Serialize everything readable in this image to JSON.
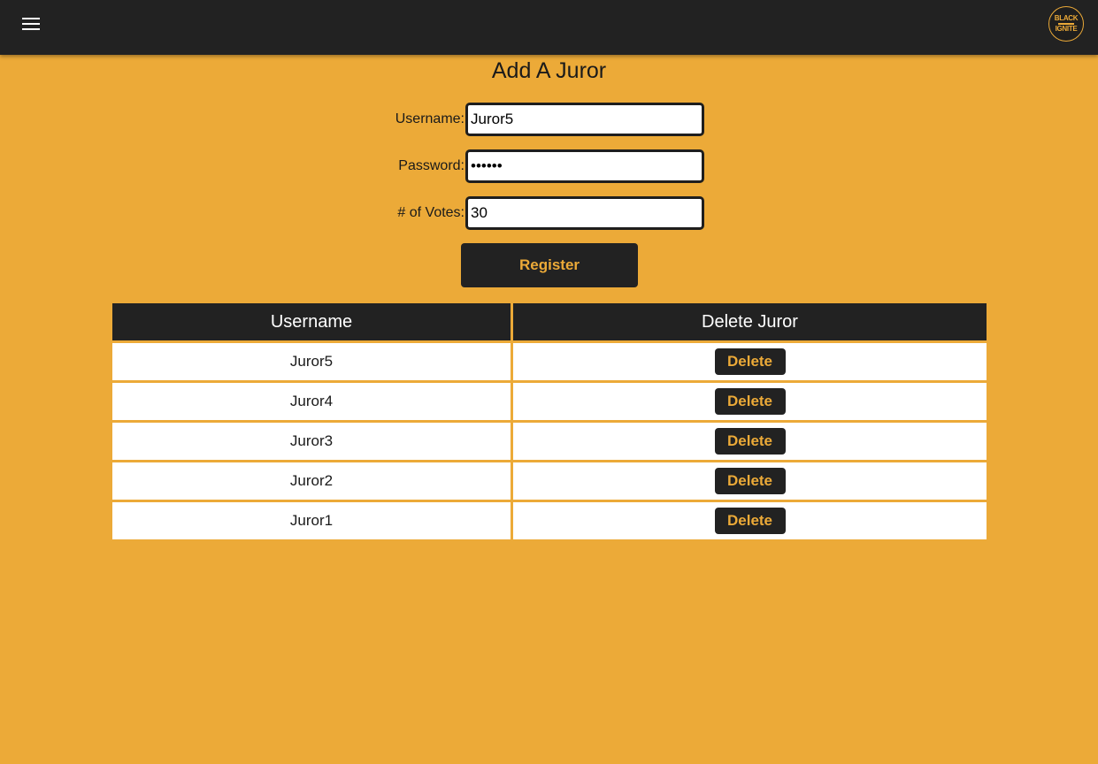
{
  "header": {
    "menu_icon": "hamburger-menu-icon",
    "logo_line1": "BLACK",
    "logo_line2": "IGNITE"
  },
  "form": {
    "title": "Add A Juror",
    "username_label": "Username:",
    "username_value": "Juror5",
    "password_label": "Password:",
    "password_value": "••••••",
    "votes_label": "# of Votes:",
    "votes_value": "30",
    "register_label": "Register"
  },
  "table": {
    "headers": [
      "Username",
      "Delete Juror"
    ],
    "delete_label": "Delete",
    "rows": [
      {
        "username": "Juror5"
      },
      {
        "username": "Juror4"
      },
      {
        "username": "Juror3"
      },
      {
        "username": "Juror2"
      },
      {
        "username": "Juror1"
      }
    ]
  },
  "colors": {
    "background": "#ecaa38",
    "dark": "#222222",
    "accent": "#ecaa38"
  }
}
